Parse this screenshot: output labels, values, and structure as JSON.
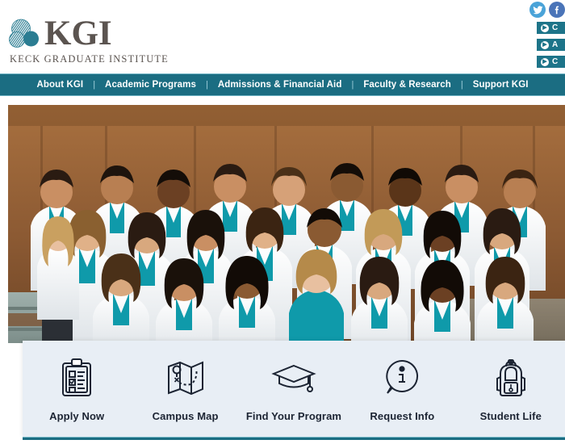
{
  "header": {
    "logo": {
      "mark_name": "kgi-circles-logo-mark",
      "title": "KGI",
      "subtitle": "KECK GRADUATE INSTITUTE",
      "color_text": "#5b5450",
      "color_accent": "#1b6d82"
    },
    "social": [
      {
        "name": "twitter-icon",
        "label": "Twitter"
      },
      {
        "name": "facebook-icon",
        "label": "Facebook"
      }
    ],
    "right_buttons": [
      {
        "label": "C",
        "icon": "chevron-right-icon"
      },
      {
        "label": "A",
        "icon": "chevron-right-icon"
      },
      {
        "label": "C",
        "icon": "chevron-right-icon"
      }
    ]
  },
  "nav": {
    "separator": "|",
    "background": "#1b6d82",
    "items": [
      {
        "label": "About KGI"
      },
      {
        "label": "Academic Programs"
      },
      {
        "label": "Admissions & Financial Aid"
      },
      {
        "label": "Faculty & Research"
      },
      {
        "label": "Support KGI"
      }
    ]
  },
  "hero": {
    "alt": "Group photo of KGI students in white lab coats with teal shirts on wooden staircase"
  },
  "quicklinks": {
    "background": "#e8eef5",
    "items": [
      {
        "label": "Apply Now",
        "icon": "clipboard-checklist-icon"
      },
      {
        "label": "Campus Map",
        "icon": "folded-map-pin-icon"
      },
      {
        "label": "Find Your Program",
        "icon": "graduation-cap-icon"
      },
      {
        "label": "Request Info",
        "icon": "info-speech-bubble-icon"
      },
      {
        "label": "Student Life",
        "icon": "backpack-icon"
      }
    ]
  }
}
